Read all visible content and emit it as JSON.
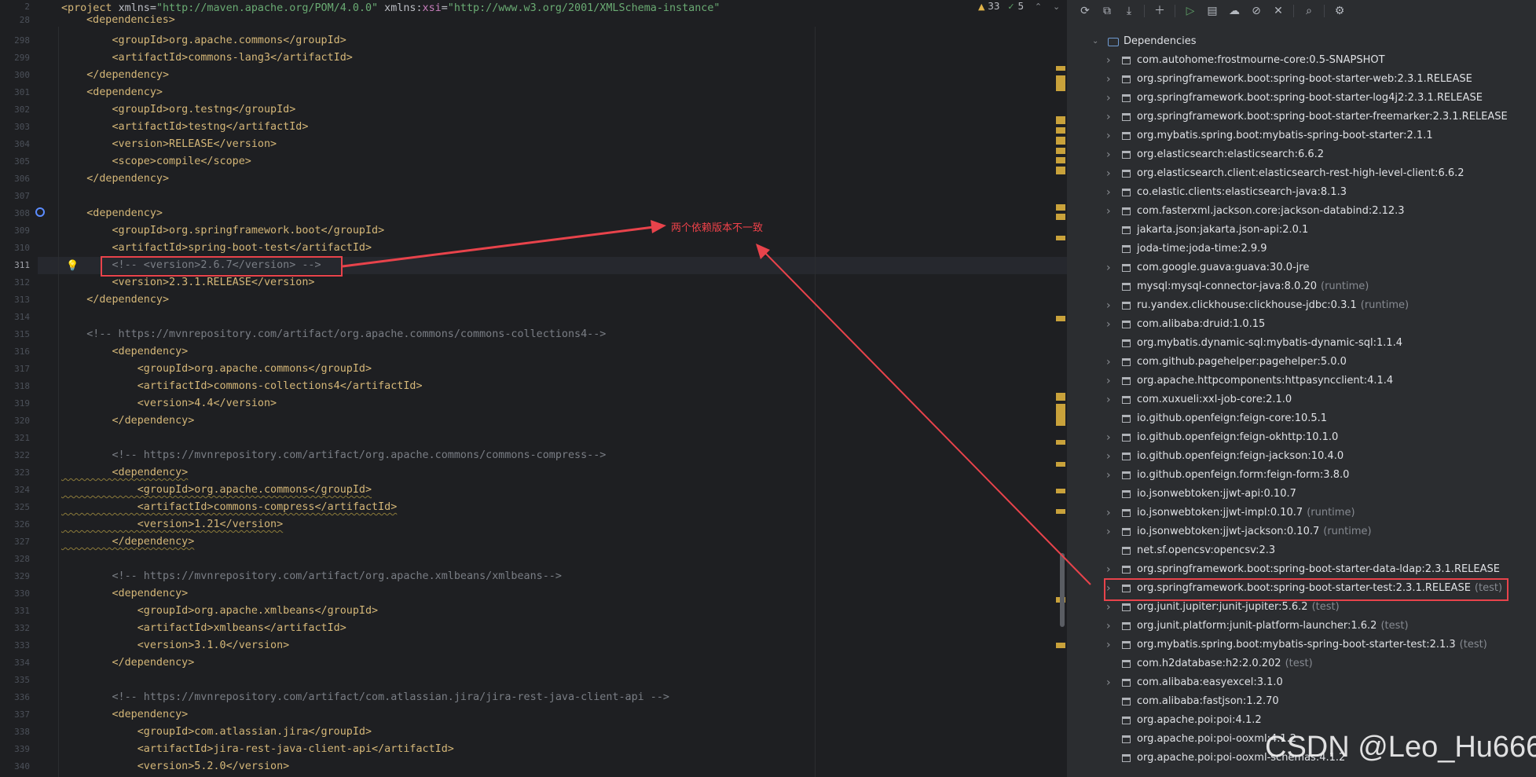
{
  "editor": {
    "header_line": {
      "number": "2",
      "tag_open": "<project ",
      "attr1": "xmlns=",
      "val1": "\"http://maven.apache.org/POM/4.0.0\"",
      "attr2": " xmlns:",
      "attr2_ns": "xsi",
      "attr2_eq": "=",
      "val2": "\"http://www.w3.org/2001/XMLSchema-instance\""
    },
    "header_line2": {
      "number": "28",
      "text": "<dependencies>"
    },
    "status": {
      "warnings": "33",
      "ok": "5"
    },
    "lines": [
      {
        "n": "298",
        "text": "        <groupId>org.apache.commons</groupId>"
      },
      {
        "n": "299",
        "text": "        <artifactId>commons-lang3</artifactId>"
      },
      {
        "n": "300",
        "text": "    </dependency>"
      },
      {
        "n": "301",
        "text": "    <dependency>"
      },
      {
        "n": "302",
        "text": "        <groupId>org.testng</groupId>"
      },
      {
        "n": "303",
        "text": "        <artifactId>testng</artifactId>"
      },
      {
        "n": "304",
        "text": "        <version>RELEASE</version>"
      },
      {
        "n": "305",
        "text": "        <scope>compile</scope>"
      },
      {
        "n": "306",
        "text": "    </dependency>"
      },
      {
        "n": "307",
        "text": ""
      },
      {
        "n": "308",
        "text": "    <dependency>"
      },
      {
        "n": "309",
        "text": "        <groupId>org.springframework.boot</groupId>"
      },
      {
        "n": "310",
        "text": "        <artifactId>spring-boot-test</artifactId>"
      },
      {
        "n": "311",
        "text": "        <!-- <version>2.6.7</version> -->",
        "comment": true
      },
      {
        "n": "312",
        "text": "        <version>2.3.1.RELEASE</version>"
      },
      {
        "n": "313",
        "text": "    </dependency>"
      },
      {
        "n": "314",
        "text": ""
      },
      {
        "n": "315",
        "text": "    <!-- https://mvnrepository.com/artifact/org.apache.commons/commons-collections4-->",
        "comment": true
      },
      {
        "n": "316",
        "text": "        <dependency>"
      },
      {
        "n": "317",
        "text": "            <groupId>org.apache.commons</groupId>"
      },
      {
        "n": "318",
        "text": "            <artifactId>commons-collections4</artifactId>"
      },
      {
        "n": "319",
        "text": "            <version>4.4</version>"
      },
      {
        "n": "320",
        "text": "        </dependency>"
      },
      {
        "n": "321",
        "text": ""
      },
      {
        "n": "322",
        "text": "        <!-- https://mvnrepository.com/artifact/org.apache.commons/commons-compress-->",
        "comment": true
      },
      {
        "n": "323",
        "text": "        <dependency>",
        "wavy": true
      },
      {
        "n": "324",
        "text": "            <groupId>org.apache.commons</groupId>",
        "wavy": true
      },
      {
        "n": "325",
        "text": "            <artifactId>commons-compress</artifactId>",
        "wavy": true
      },
      {
        "n": "326",
        "text": "            <version>1.21</version>",
        "wavy": true
      },
      {
        "n": "327",
        "text": "        </dependency>",
        "wavy": true
      },
      {
        "n": "328",
        "text": ""
      },
      {
        "n": "329",
        "text": "        <!-- https://mvnrepository.com/artifact/org.apache.xmlbeans/xmlbeans-->",
        "comment": true
      },
      {
        "n": "330",
        "text": "        <dependency>"
      },
      {
        "n": "331",
        "text": "            <groupId>org.apache.xmlbeans</groupId>"
      },
      {
        "n": "332",
        "text": "            <artifactId>xmlbeans</artifactId>"
      },
      {
        "n": "333",
        "text": "            <version>3.1.0</version>"
      },
      {
        "n": "334",
        "text": "        </dependency>"
      },
      {
        "n": "335",
        "text": ""
      },
      {
        "n": "336",
        "text": "        <!-- https://mvnrepository.com/artifact/com.atlassian.jira/jira-rest-java-client-api -->",
        "comment": true
      },
      {
        "n": "337",
        "text": "        <dependency>"
      },
      {
        "n": "338",
        "text": "            <groupId>com.atlassian.jira</groupId>"
      },
      {
        "n": "339",
        "text": "            <artifactId>jira-rest-java-client-api</artifactId>"
      },
      {
        "n": "340",
        "text": "            <version>5.2.0</version>"
      }
    ]
  },
  "maven": {
    "top_item": "Dependencies",
    "deps": [
      {
        "label": "com.autohome:frostmourne-core:0.5-SNAPSHOT",
        "scope": "",
        "expandable": true
      },
      {
        "label": "org.springframework.boot:spring-boot-starter-web:2.3.1.RELEASE",
        "scope": "",
        "expandable": true
      },
      {
        "label": "org.springframework.boot:spring-boot-starter-log4j2:2.3.1.RELEASE",
        "scope": "",
        "expandable": true
      },
      {
        "label": "org.springframework.boot:spring-boot-starter-freemarker:2.3.1.RELEASE",
        "scope": "",
        "expandable": true
      },
      {
        "label": "org.mybatis.spring.boot:mybatis-spring-boot-starter:2.1.1",
        "scope": "",
        "expandable": true
      },
      {
        "label": "org.elasticsearch:elasticsearch:6.6.2",
        "scope": "",
        "expandable": true
      },
      {
        "label": "org.elasticsearch.client:elasticsearch-rest-high-level-client:6.6.2",
        "scope": "",
        "expandable": true
      },
      {
        "label": "co.elastic.clients:elasticsearch-java:8.1.3",
        "scope": "",
        "expandable": true
      },
      {
        "label": "com.fasterxml.jackson.core:jackson-databind:2.12.3",
        "scope": "",
        "expandable": true
      },
      {
        "label": "jakarta.json:jakarta.json-api:2.0.1",
        "scope": "",
        "expandable": false
      },
      {
        "label": "joda-time:joda-time:2.9.9",
        "scope": "",
        "expandable": false
      },
      {
        "label": "com.google.guava:guava:30.0-jre",
        "scope": "",
        "expandable": true
      },
      {
        "label": "mysql:mysql-connector-java:8.0.20",
        "scope": "(runtime)",
        "expandable": false
      },
      {
        "label": "ru.yandex.clickhouse:clickhouse-jdbc:0.3.1",
        "scope": "(runtime)",
        "expandable": true
      },
      {
        "label": "com.alibaba:druid:1.0.15",
        "scope": "",
        "expandable": true
      },
      {
        "label": "org.mybatis.dynamic-sql:mybatis-dynamic-sql:1.1.4",
        "scope": "",
        "expandable": false
      },
      {
        "label": "com.github.pagehelper:pagehelper:5.0.0",
        "scope": "",
        "expandable": true
      },
      {
        "label": "org.apache.httpcomponents:httpasyncclient:4.1.4",
        "scope": "",
        "expandable": true
      },
      {
        "label": "com.xuxueli:xxl-job-core:2.1.0",
        "scope": "",
        "expandable": true
      },
      {
        "label": "io.github.openfeign:feign-core:10.5.1",
        "scope": "",
        "expandable": false
      },
      {
        "label": "io.github.openfeign:feign-okhttp:10.1.0",
        "scope": "",
        "expandable": true
      },
      {
        "label": "io.github.openfeign:feign-jackson:10.4.0",
        "scope": "",
        "expandable": true
      },
      {
        "label": "io.github.openfeign.form:feign-form:3.8.0",
        "scope": "",
        "expandable": true
      },
      {
        "label": "io.jsonwebtoken:jjwt-api:0.10.7",
        "scope": "",
        "expandable": false
      },
      {
        "label": "io.jsonwebtoken:jjwt-impl:0.10.7",
        "scope": "(runtime)",
        "expandable": true
      },
      {
        "label": "io.jsonwebtoken:jjwt-jackson:0.10.7",
        "scope": "(runtime)",
        "expandable": true
      },
      {
        "label": "net.sf.opencsv:opencsv:2.3",
        "scope": "",
        "expandable": false
      },
      {
        "label": "org.springframework.boot:spring-boot-starter-data-ldap:2.3.1.RELEASE",
        "scope": "",
        "expandable": true
      },
      {
        "label": "org.springframework.boot:spring-boot-starter-test:2.3.1.RELEASE",
        "scope": "(test)",
        "expandable": true
      },
      {
        "label": "org.junit.jupiter:junit-jupiter:5.6.2",
        "scope": "(test)",
        "expandable": true
      },
      {
        "label": "org.junit.platform:junit-platform-launcher:1.6.2",
        "scope": "(test)",
        "expandable": true
      },
      {
        "label": "org.mybatis.spring.boot:mybatis-spring-boot-starter-test:2.1.3",
        "scope": "(test)",
        "expandable": true
      },
      {
        "label": "com.h2database:h2:2.0.202",
        "scope": "(test)",
        "expandable": false
      },
      {
        "label": "com.alibaba:easyexcel:3.1.0",
        "scope": "",
        "expandable": true
      },
      {
        "label": "com.alibaba:fastjson:1.2.70",
        "scope": "",
        "expandable": false
      },
      {
        "label": "org.apache.poi:poi:4.1.2",
        "scope": "",
        "expandable": false
      },
      {
        "label": "org.apache.poi:poi-ooxml:4.1.2",
        "scope": "",
        "expandable": false
      },
      {
        "label": "org.apache.poi:poi-ooxml-schemas:4.1.2",
        "scope": "",
        "expandable": false
      }
    ]
  },
  "annotation": {
    "text": "两个依赖版本不一致"
  },
  "watermark": {
    "text": "CSDN @Leo_Hu666"
  },
  "colors": {
    "annotation": "#e8434b",
    "tag": "#d5b778",
    "string": "#6aab73",
    "comment": "#7a7e85",
    "background": "#1e1f22",
    "panel": "#2b2d30"
  }
}
